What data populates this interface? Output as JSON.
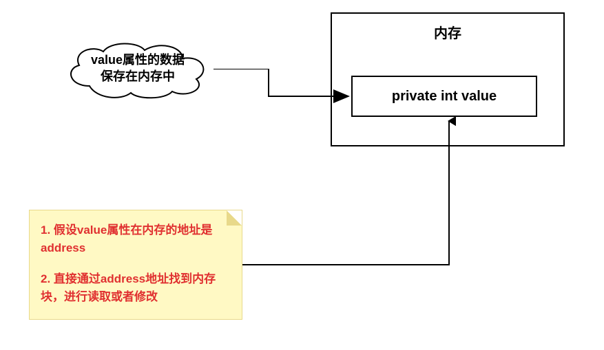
{
  "memory": {
    "title": "内存",
    "value_field": "private int value"
  },
  "cloud": {
    "line1": "value属性的数据",
    "line2": "保存在内存中"
  },
  "note": {
    "point1": "1. 假设value属性在内存的地址是address",
    "point2": "2. 直接通过address地址找到内存块，进行读取或者修改"
  }
}
